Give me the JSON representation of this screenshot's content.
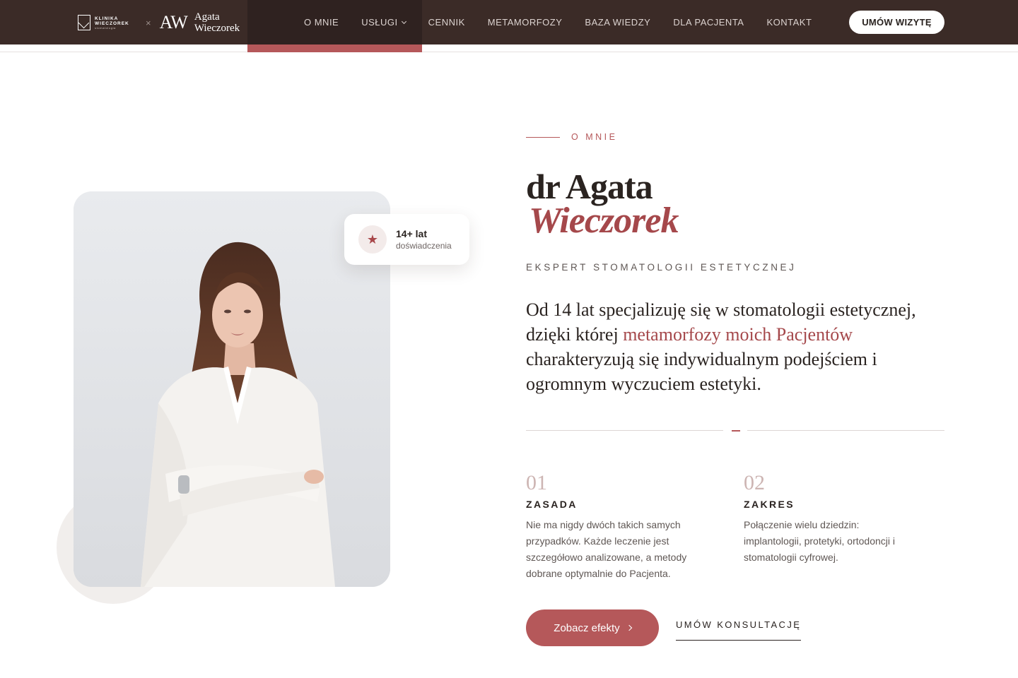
{
  "header": {
    "logo_klinika": "KLINIKA WIECZOREK",
    "logo_klinika_sub": "stomatologia",
    "brand_separator": "×",
    "brand_monogram": "AW",
    "brand_name_line1": "Agata",
    "brand_name_line2": "Wieczorek",
    "nav": [
      {
        "label": "O MNIE"
      },
      {
        "label": "USŁUGI"
      },
      {
        "label": "CENNIK"
      },
      {
        "label": "METAMORFOZY"
      },
      {
        "label": "BAZA WIEDZY"
      },
      {
        "label": "DLA PACJENTA"
      },
      {
        "label": "KONTAKT"
      }
    ],
    "cta_label": "UMÓW WIZYTĘ"
  },
  "badge": {
    "icon": "star-icon",
    "title": "14+ lat",
    "subtitle": "doświadczenia"
  },
  "hero": {
    "eyebrow": "O MNIE",
    "name_line1": "dr Agata",
    "name_line2": "Wieczorek",
    "subtitle": "EKSPERT STOMATOLOGII ESTETYCZNEJ",
    "lead_part1": "Od 14 lat specjalizuję się w stomatologii estetycznej, dzięki której ",
    "lead_accent": "metamorfozy moich Pacjentów",
    "lead_part2": " charakteryzują się indywidualnym podejściem i ogromnym wyczuciem estetyki."
  },
  "features": [
    {
      "num": "01",
      "title": "ZASADA",
      "text": "Nie ma nigdy dwóch takich samych przypadków. Każde leczenie jest szczegółowo analizowane, a metody dobrane optymalnie do Pacjenta."
    },
    {
      "num": "02",
      "title": "ZAKRES",
      "text": "Połączenie wielu dziedzin: implantologii, protetyki, ortodoncji i stomatologii cyfrowej."
    }
  ],
  "actions": {
    "primary_label": "Zobacz efekty",
    "secondary_label": "UMÓW KONSULTACJĘ"
  },
  "colors": {
    "header_bg": "#3b2b27",
    "accent": "#b5585a",
    "accent_text": "#a5484b",
    "text_dark": "#2a2320"
  }
}
